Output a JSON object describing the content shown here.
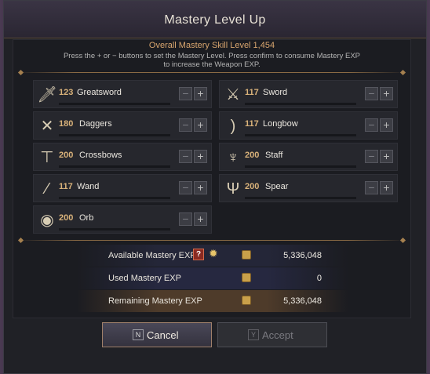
{
  "dialog": {
    "title": "Mastery Level Up",
    "overall": "Overall Mastery Skill Level 1,454",
    "description": "Press the + or − buttons to set the Mastery Level. Press confirm to consume Mastery EXP to increase the Weapon EXP."
  },
  "skills": [
    {
      "level": "123",
      "name": "Greatsword",
      "icon": "greatsword-icon"
    },
    {
      "level": "117",
      "name": "Sword",
      "icon": "sword-icon"
    },
    {
      "level": "180",
      "name": "Daggers",
      "icon": "daggers-icon"
    },
    {
      "level": "117",
      "name": "Longbow",
      "icon": "longbow-icon"
    },
    {
      "level": "200",
      "name": "Crossbows",
      "icon": "crossbow-icon"
    },
    {
      "level": "200",
      "name": "Staff",
      "icon": "staff-icon"
    },
    {
      "level": "117",
      "name": "Wand",
      "icon": "wand-icon"
    },
    {
      "level": "200",
      "name": "Spear",
      "icon": "spear-icon"
    },
    {
      "level": "200",
      "name": "Orb",
      "icon": "orb-icon"
    }
  ],
  "summary": {
    "available_label": "Available Mastery EXP",
    "available_value": "5,336,048",
    "help": "?",
    "used_label": "Used Mastery EXP",
    "used_value": "0",
    "remaining_label": "Remaining Mastery EXP",
    "remaining_value": "5,336,048"
  },
  "buttons": {
    "cancel_key": "N",
    "cancel_label": "Cancel",
    "accept_key": "Y",
    "accept_label": "Accept"
  },
  "colors": {
    "accent": "#d9b27a",
    "remaining_row": "#4e3b2a"
  }
}
